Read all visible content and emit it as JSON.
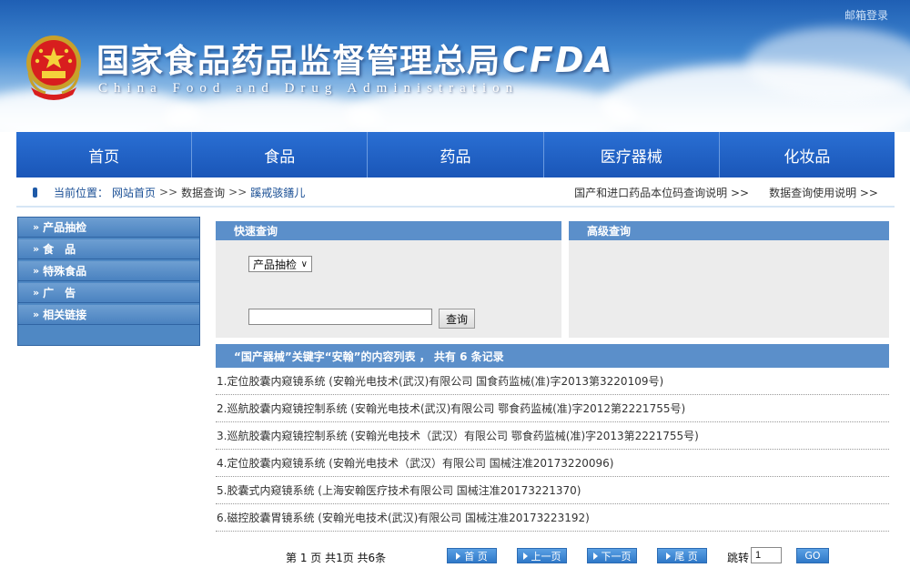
{
  "header": {
    "login_link": "邮箱登录",
    "title_cn": "国家食品药品监督管理总局",
    "title_en": "China Food and Drug Administration",
    "logo_text": "CFDA"
  },
  "nav": {
    "items": [
      {
        "label": "首页"
      },
      {
        "label": "食品"
      },
      {
        "label": "药品"
      },
      {
        "label": "医疗器械"
      },
      {
        "label": "化妆品"
      }
    ]
  },
  "breadcrumb": {
    "label": "当前位置：",
    "home": "网站首页",
    "sep": ">>",
    "level2": "数据查询",
    "level3": "蹊戒骇鐥儿",
    "right_links": [
      "国产和进口药品本位码查询说明 >>",
      "数据查询使用说明 >>"
    ]
  },
  "sidebar": {
    "arrow": "»",
    "items": [
      "产品抽检",
      "食　品",
      "特殊食品",
      "广　告",
      "相关链接"
    ]
  },
  "quick_search": {
    "title": "快速查询",
    "select_value": "产品抽检",
    "input_value": "",
    "button_label": "查询"
  },
  "advanced_search": {
    "title": "高级查询"
  },
  "results": {
    "header": "“国产器械”关键字“安翰”的内容列表 ， 共有 6 条记录",
    "rows": [
      "1.定位胶囊内窥镜系统 (安翰光电技术(武汉)有限公司 国食药监械(准)字2013第3220109号)",
      "2.巡航胶囊内窥镜控制系统 (安翰光电技术(武汉)有限公司 鄂食药监械(准)字2012第2221755号)",
      "3.巡航胶囊内窥镜控制系统 (安翰光电技术（武汉）有限公司 鄂食药监械(准)字2013第2221755号)",
      "4.定位胶囊内窥镜系统 (安翰光电技术（武汉）有限公司 国械注准20173220096)",
      "5.胶囊式内窥镜系统 (上海安翰医疗技术有限公司 国械注准20173221370)",
      "6.磁控胶囊胃镜系统 (安翰光电技术(武汉)有限公司 国械注准20173223192)"
    ]
  },
  "pager": {
    "info": "第 1 页 共1页 共6条",
    "first": "首 页",
    "prev": "上一页",
    "next": "下一页",
    "last": "尾 页",
    "jump_label": "跳转",
    "jump_value": "1",
    "go": "GO"
  }
}
